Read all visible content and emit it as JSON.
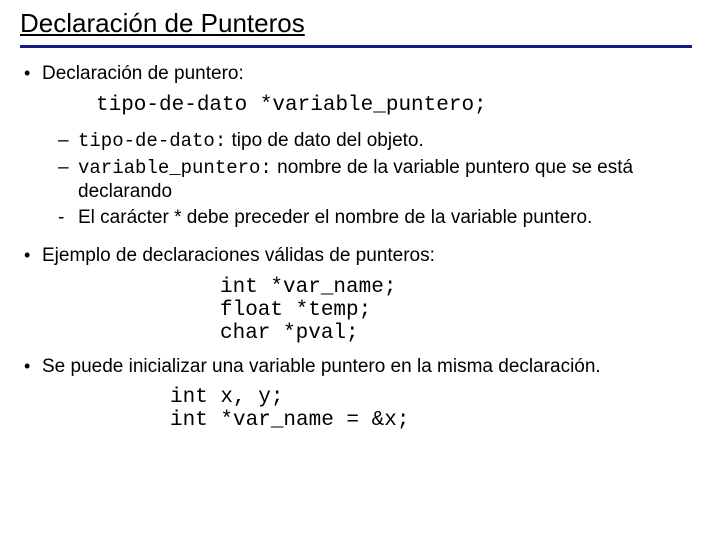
{
  "title": "Declaración de Punteros",
  "bullet1": "Declaración de puntero:",
  "code_decl": "tipo-de-dato *variable_puntero;",
  "sub": {
    "a_mono": "tipo-de-dato:",
    "a_text": " tipo de dato del objeto.",
    "b_mono": "variable_puntero:",
    "b_text": " nombre de la variable puntero que se está declarando",
    "c_text": "El carácter * debe preceder el nombre de la variable puntero."
  },
  "bullet2": "Ejemplo de declaraciones válidas de punteros:",
  "code_examples": "int *var_name;\nfloat *temp;\nchar *pval;",
  "bullet3": "Se puede inicializar una variable puntero en la misma declaración.",
  "code_init": "int x, y;\nint *var_name = &x;"
}
